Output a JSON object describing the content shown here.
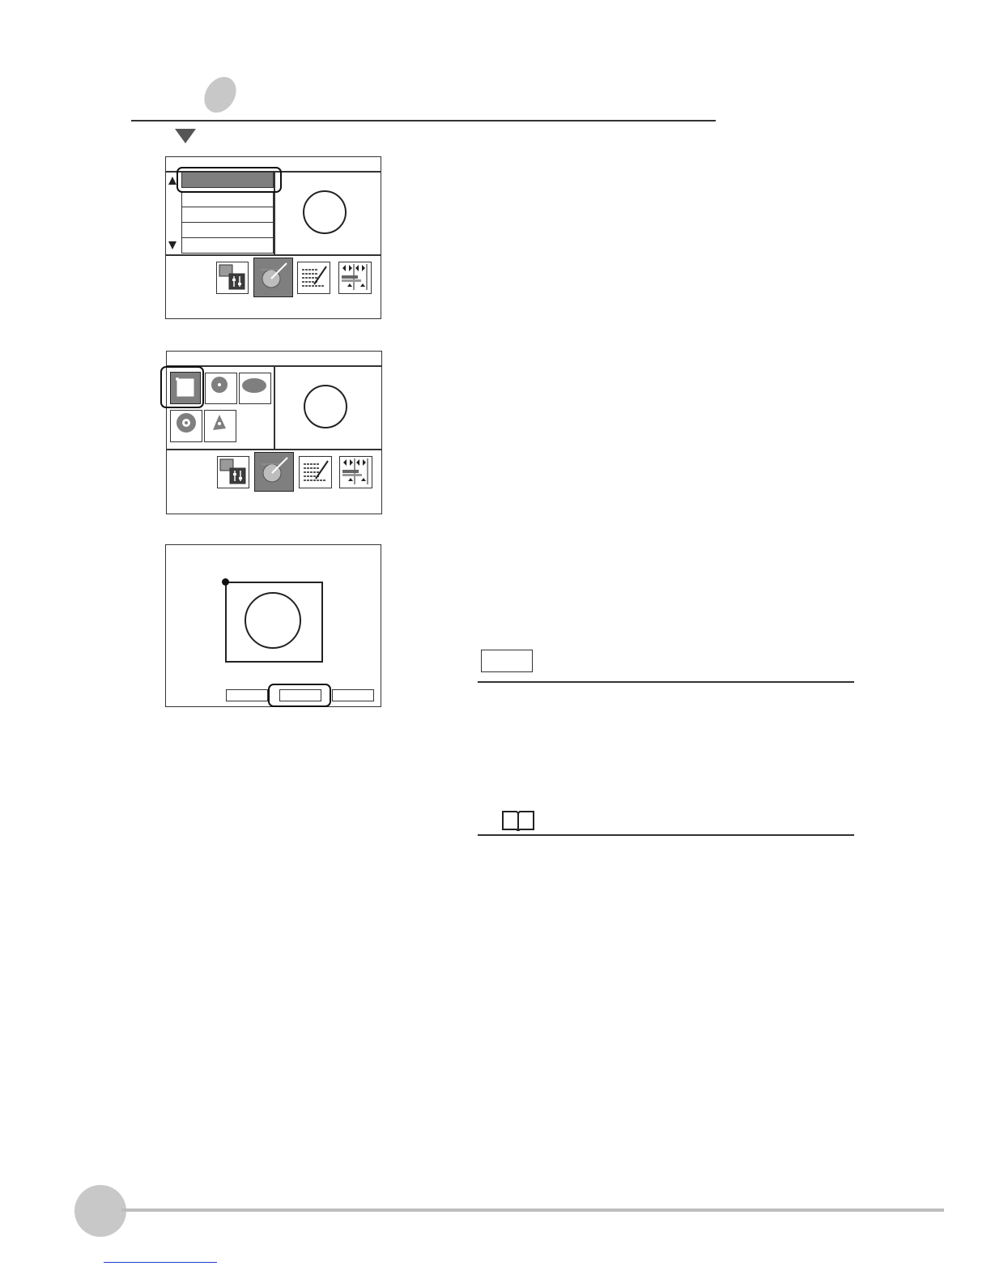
{
  "colors": {
    "ink": "#1a1a1a",
    "selected_fill": "#7f7f7f",
    "section_badge": "#c8c8c8",
    "footer_rule": "#bdbdbd",
    "link": "#1f3fc4"
  },
  "header": {
    "section_badge_icon": "section-badge-icon",
    "step_marker_icon": "triangle-down-icon"
  },
  "screen1": {
    "list_items": [
      "",
      "",
      "",
      "",
      ""
    ],
    "scroll_up_icon": "triangle-up-icon",
    "scroll_down_icon": "triangle-down-icon",
    "toolbar_icons": [
      "camera-settings-icon",
      "region-edit-icon",
      "list-edit-icon",
      "threshold-icon"
    ],
    "active_tool_index": 1
  },
  "screen2": {
    "shape_icons": [
      "rectangle-shape-icon",
      "circle-shape-icon",
      "ellipse-shape-icon",
      "ring-shape-icon",
      "polygon-shape-icon"
    ],
    "selected_shape_index": 0,
    "toolbar_icons": [
      "camera-settings-icon",
      "region-edit-icon",
      "list-edit-icon",
      "threshold-icon"
    ],
    "active_tool_index": 1
  },
  "screen3": {
    "buttons": [
      "",
      "",
      ""
    ],
    "selected_button_index": 1
  },
  "notes": {
    "important_label": "",
    "reference_icon": "book-icon"
  },
  "footer": {
    "page_badge_icon": "page-number-badge-icon",
    "link_text": ""
  }
}
